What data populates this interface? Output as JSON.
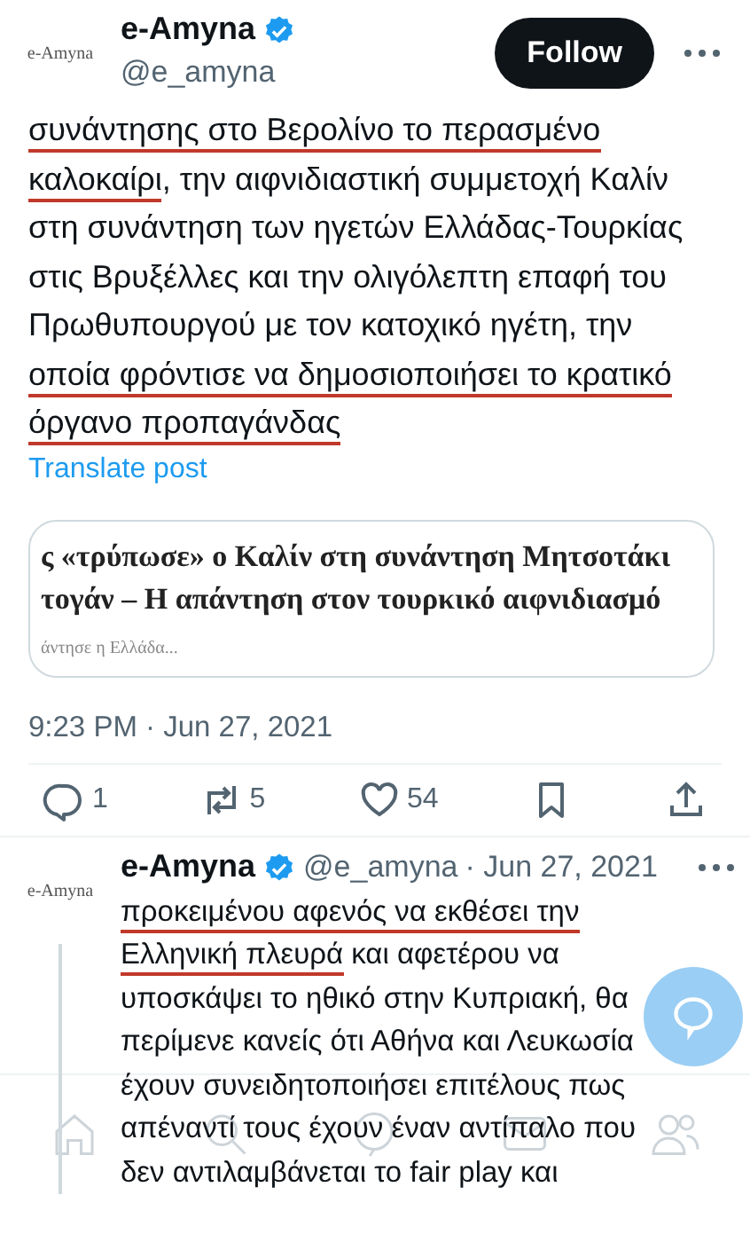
{
  "post": {
    "avatar_text": "e-Amyna",
    "author": "e-Amyna",
    "verified": true,
    "handle": "@e_amyna",
    "follow_button": "Follow",
    "segments": [
      {
        "text": "συνάντησης στο Βερολίνο το περασμένο ",
        "underlined": true
      },
      {
        "text": "καλοκαίρι",
        "underlined": true
      },
      {
        "text": ", την αιφνιδιαστική συμμετοχή Καλίν στη συνάντηση των ηγετών Ελλάδας-Τουρκίας στις Βρυξέλλες και την ολιγόλεπτη επαφή του Πρωθυπουργού με τον κατοχικό ηγέτη, την ",
        "underlined": false
      },
      {
        "text": "οποία φρόντισε να δημοσιοποιήσει το κρατικό όργανο προπαγάνδας",
        "underlined": true
      }
    ],
    "translate": "Translate post",
    "link_card": {
      "title_lines": [
        "ς «τρύπωσε» ο Καλίν στη συνάντηση Μητσοτάκι",
        "τογάν – Η απάντηση στον τουρκικό αιφνιδιασμό"
      ],
      "subtitle": "άντησε η Ελλάδα..."
    },
    "timestamp": "9:23 PM · Jun 27, 2021",
    "actions": [
      {
        "kind": "reply",
        "count": "1"
      },
      {
        "kind": "repost",
        "count": "5"
      },
      {
        "kind": "like",
        "count": "54"
      },
      {
        "kind": "bookmark"
      },
      {
        "kind": "share"
      }
    ]
  },
  "reply": {
    "avatar_text": "e-Amyna",
    "author": "e-Amyna",
    "verified": true,
    "handle": "@e_amyna",
    "date": "· Jun 27, 2021",
    "segments": [
      {
        "text": "προκειμένου αφενός να εκθέσει την Ελληνική πλευρά",
        "underlined": true
      },
      {
        "text": " και αφετέρου να υποσκάψει το ηθικό στην Κυπριακή, θα περίμενε κανείς ότι Αθήνα και Λευκωσία έχουν συνειδητοποιήσει επιτέλους πως απέναντί τους έχουν έναν αντίπαλο που δεν αντιλαμβάνεται το fair play και",
        "underlined": false
      }
    ]
  },
  "bottom_nav": [
    {
      "kind": "home"
    },
    {
      "kind": "search"
    },
    {
      "kind": "circle"
    },
    {
      "kind": "mail"
    },
    {
      "kind": "people"
    }
  ]
}
